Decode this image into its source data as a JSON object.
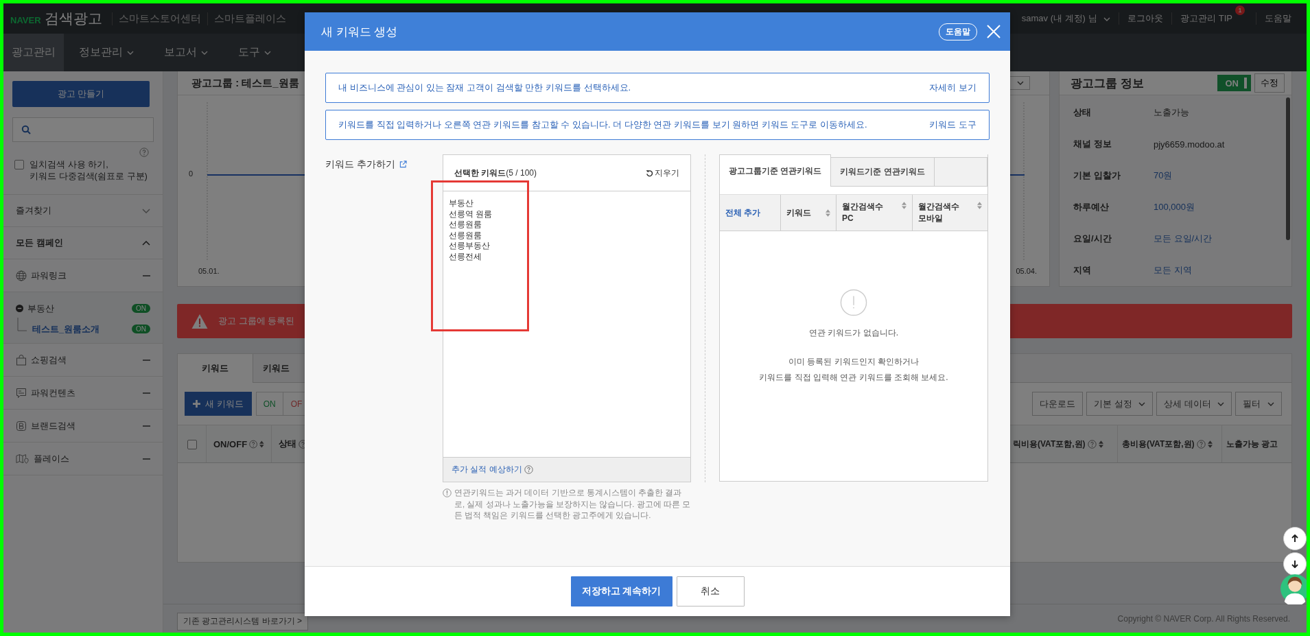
{
  "header": {
    "logo_brand": "NAVER",
    "logo_title": "검색광고",
    "links": [
      "스마트스토어센터",
      "스마트플레이스"
    ],
    "account": "samav (내 계정) 님",
    "logout": "로그아웃",
    "tip": "광고관리 TIP",
    "tip_badge": "1",
    "help": "도움말"
  },
  "nav": [
    {
      "label": "광고관리",
      "selected": true,
      "dropdown": false
    },
    {
      "label": "정보관리",
      "selected": false,
      "dropdown": true
    },
    {
      "label": "보고서",
      "selected": false,
      "dropdown": true
    },
    {
      "label": "도구",
      "selected": false,
      "dropdown": true
    }
  ],
  "sidebar": {
    "create_button": "광고 만들기",
    "exact_match": {
      "checked": false,
      "lines": [
        "일치검색 사용 하기,",
        "키워드 다중검색(쉼표로 구분)"
      ]
    },
    "favorites": {
      "label": "즐겨찾기",
      "expanded": false
    },
    "all_campaigns": {
      "label": "모든 캠페인",
      "expanded": true
    },
    "campaigns": [
      {
        "kind": "powerlink",
        "label": "파워링크",
        "expanded": false
      },
      {
        "kind": "group",
        "label": "부동산",
        "status": "ON",
        "expanded": true,
        "children": [
          {
            "label": "테스트_원룸소개",
            "status": "ON",
            "selected": true
          }
        ]
      },
      {
        "kind": "shopping",
        "label": "쇼핑검색",
        "expanded": false
      },
      {
        "kind": "content",
        "label": "파워컨텐츠",
        "expanded": false
      },
      {
        "kind": "brand",
        "label": "브랜드검색",
        "expanded": false
      },
      {
        "kind": "place",
        "label": "플레이스",
        "expanded": false
      }
    ]
  },
  "main": {
    "title": "광고그룹 : 테스트_원룸",
    "chart": {
      "y_label": "0",
      "x_start": "05.01.",
      "x_end": "05.04."
    },
    "info": {
      "title": "광고그룹 정보",
      "on": true,
      "toggle_label": "ON",
      "edit": "수정",
      "rows": [
        {
          "label": "상태",
          "value": "노출가능",
          "link": false
        },
        {
          "label": "채널 정보",
          "value": "pjy6659.modoo.at",
          "link": false
        },
        {
          "label": "기본 입찰가",
          "value": "70원",
          "link": true
        },
        {
          "label": "하루예산",
          "value": "100,000원",
          "link": true
        },
        {
          "label": "요일/시간",
          "value": "모든 요일/시간",
          "link": true
        },
        {
          "label": "지역",
          "value": "모든 지역",
          "link": true
        }
      ]
    },
    "alert": "광고 그룹에 등록된",
    "select_all": {
      "checked": false
    },
    "tabs": [
      {
        "label": "키워드",
        "selected": true
      },
      {
        "label": "키워드",
        "selected": false
      }
    ],
    "toolbar": {
      "new_keyword": "새 키워드",
      "on": "ON",
      "off": "OF",
      "right": [
        {
          "label": "다운로드",
          "dropdown": false
        },
        {
          "label": "기본 설정",
          "dropdown": true
        },
        {
          "label": "상세 데이터",
          "dropdown": true
        },
        {
          "label": "필터",
          "dropdown": true
        }
      ]
    },
    "columns_left": [
      {
        "label": "ON/OFF",
        "help": true,
        "sort": true
      },
      {
        "label": "상태",
        "help": true,
        "sort": false
      }
    ],
    "columns_right": [
      {
        "label": "릭비용(VAT포함,원)",
        "help": true,
        "sort": true
      },
      {
        "label": "총비용(VAT포함,원)",
        "help": true,
        "sort": true
      },
      {
        "label": "노출가능 광고",
        "help": false,
        "sort": false
      }
    ],
    "bottom_link": "기존 광고관리시스템 바로가기 >",
    "copyright": "Copyright © NAVER Corp. All Rights Reserved."
  },
  "modal": {
    "title": "새 키워드 생성",
    "help": "도움말",
    "notices": [
      {
        "text": "내 비즈니스에 관심이 있는 잠재 고객이 검색할 만한 키워드를 선택하세요.",
        "link": "자세히 보기"
      },
      {
        "text": "키워드를 직접 입력하거나 오른쪽 연관 키워드를 참고할 수 있습니다. 더 다양한 연관 키워드를 보기 원하면 키워드 도구로 이동하세요.",
        "link": "키워드 도구"
      }
    ],
    "add_label": "키워드 추가하기",
    "selected": {
      "title": "선택한 키워드",
      "count": "(5 / 100)",
      "clear": "지우기",
      "keywords": [
        "부동산",
        "선릉역 원룸",
        "선릉원룸",
        "선릉원룸",
        "선릉부동산",
        "선릉전세"
      ],
      "highlight_frame": true,
      "forecast": "추가 실적 예상하기"
    },
    "disclaimer": "연관키워드는 과거 데이터 기반으로 통계시스템이 추출한 결과로, 실제 성과나 노출가능을 보장하지는 않습니다. 광고에 따른 모든 법적 책임은 키워드를 선택한 광고주에게 있습니다.",
    "related": {
      "tabs": [
        {
          "label": "광고그룹기준 연관키워드",
          "selected": true
        },
        {
          "label": "키워드기준 연관키워드",
          "selected": false
        }
      ],
      "columns": [
        {
          "lines": [
            "전체 추가"
          ],
          "kind": "action"
        },
        {
          "lines": [
            "키워드"
          ],
          "kind": "sort"
        },
        {
          "lines": [
            "월간검색수",
            "PC"
          ],
          "kind": "sort"
        },
        {
          "lines": [
            "월간검색수",
            "모바일"
          ],
          "kind": "sort"
        }
      ],
      "empty_title": "연관 키워드가 없습니다.",
      "empty_lines": [
        "이미 등록된 키워드인지 확인하거나",
        "키워드를 직접 입력해 연관 키워드를 조회해 보세요."
      ]
    },
    "buttons": [
      {
        "label": "저장하고 계속하기",
        "kind": "primary"
      },
      {
        "label": "취소",
        "kind": "secondary"
      }
    ]
  }
}
